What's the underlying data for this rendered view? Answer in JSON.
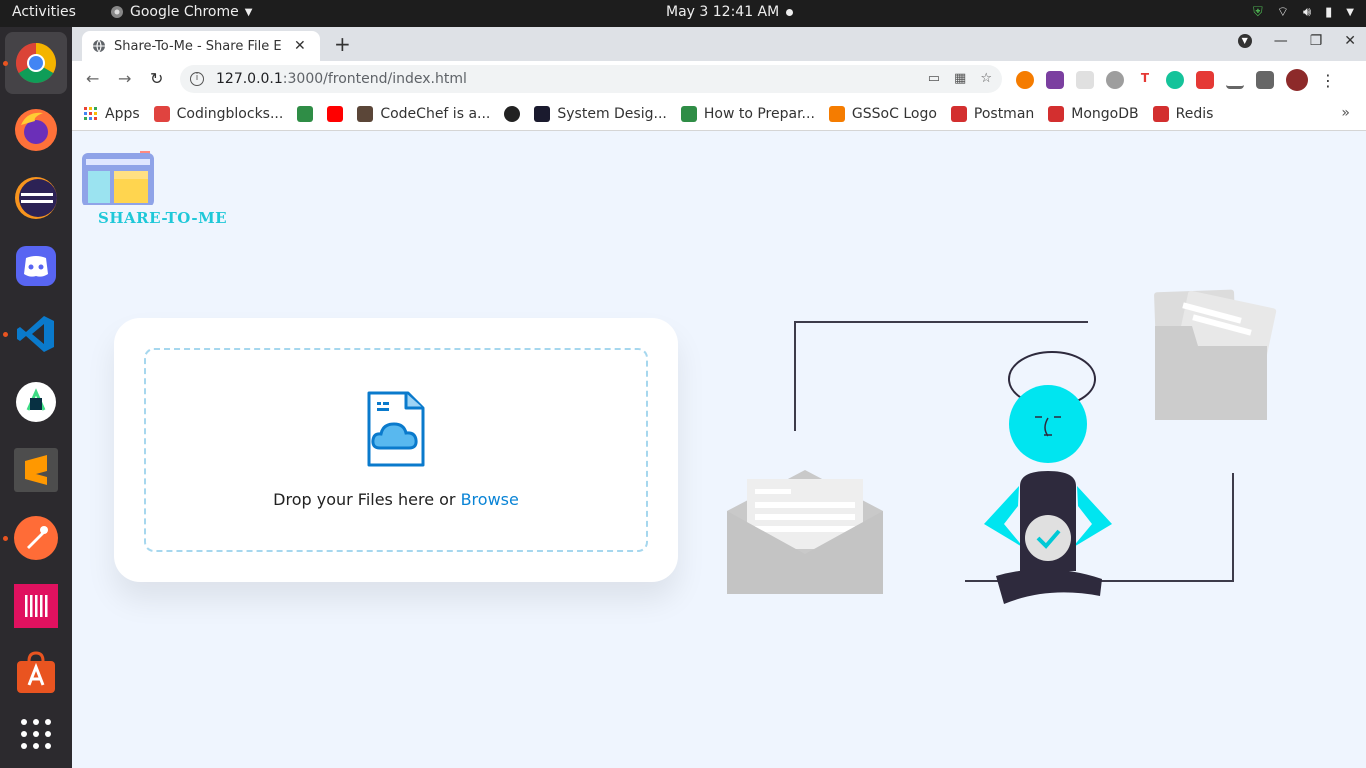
{
  "system_bar": {
    "activities": "Activities",
    "app_name": "Google Chrome",
    "datetime": "May 3  12:41 AM"
  },
  "dock": {
    "items": [
      "Google Chrome",
      "Firefox",
      "Eclipse",
      "Discord",
      "Visual Studio Code",
      "Android Studio",
      "Sublime Text",
      "Postman",
      "GitKraken",
      "Ubuntu Software",
      "Show Applications"
    ]
  },
  "browser": {
    "tab_title": "Share-To-Me - Share File E",
    "url_host": "127.0.0.1",
    "url_path": ":3000/frontend/index.html",
    "bookmarks": [
      {
        "label": "Apps",
        "color": "#4285f4"
      },
      {
        "label": "Codingblocks...",
        "color": "#e0433f"
      },
      {
        "label": "",
        "color": "#2f8d46"
      },
      {
        "label": "",
        "color": "#ff0000"
      },
      {
        "label": "CodeChef is a...",
        "color": "#5b4638"
      },
      {
        "label": "",
        "color": "#222222"
      },
      {
        "label": "System Desig...",
        "color": "#1a1a2e"
      },
      {
        "label": "How to Prepar...",
        "color": "#2f8d46"
      },
      {
        "label": "GSSoC Logo",
        "color": "#f57c00"
      },
      {
        "label": "Postman",
        "color": "#d32f2f"
      },
      {
        "label": "MongoDB",
        "color": "#d32f2f"
      },
      {
        "label": "Redis",
        "color": "#d32f2f"
      }
    ]
  },
  "page": {
    "logo_text": "SHARE-TO-ME",
    "drop_text": "Drop your Files here or ",
    "browse_label": "Browse"
  },
  "colors": {
    "accent": "#0a84d6",
    "brand": "#1fc8d8",
    "page_bg": "#eff5fe",
    "dashed_border": "#a6d7ee"
  }
}
